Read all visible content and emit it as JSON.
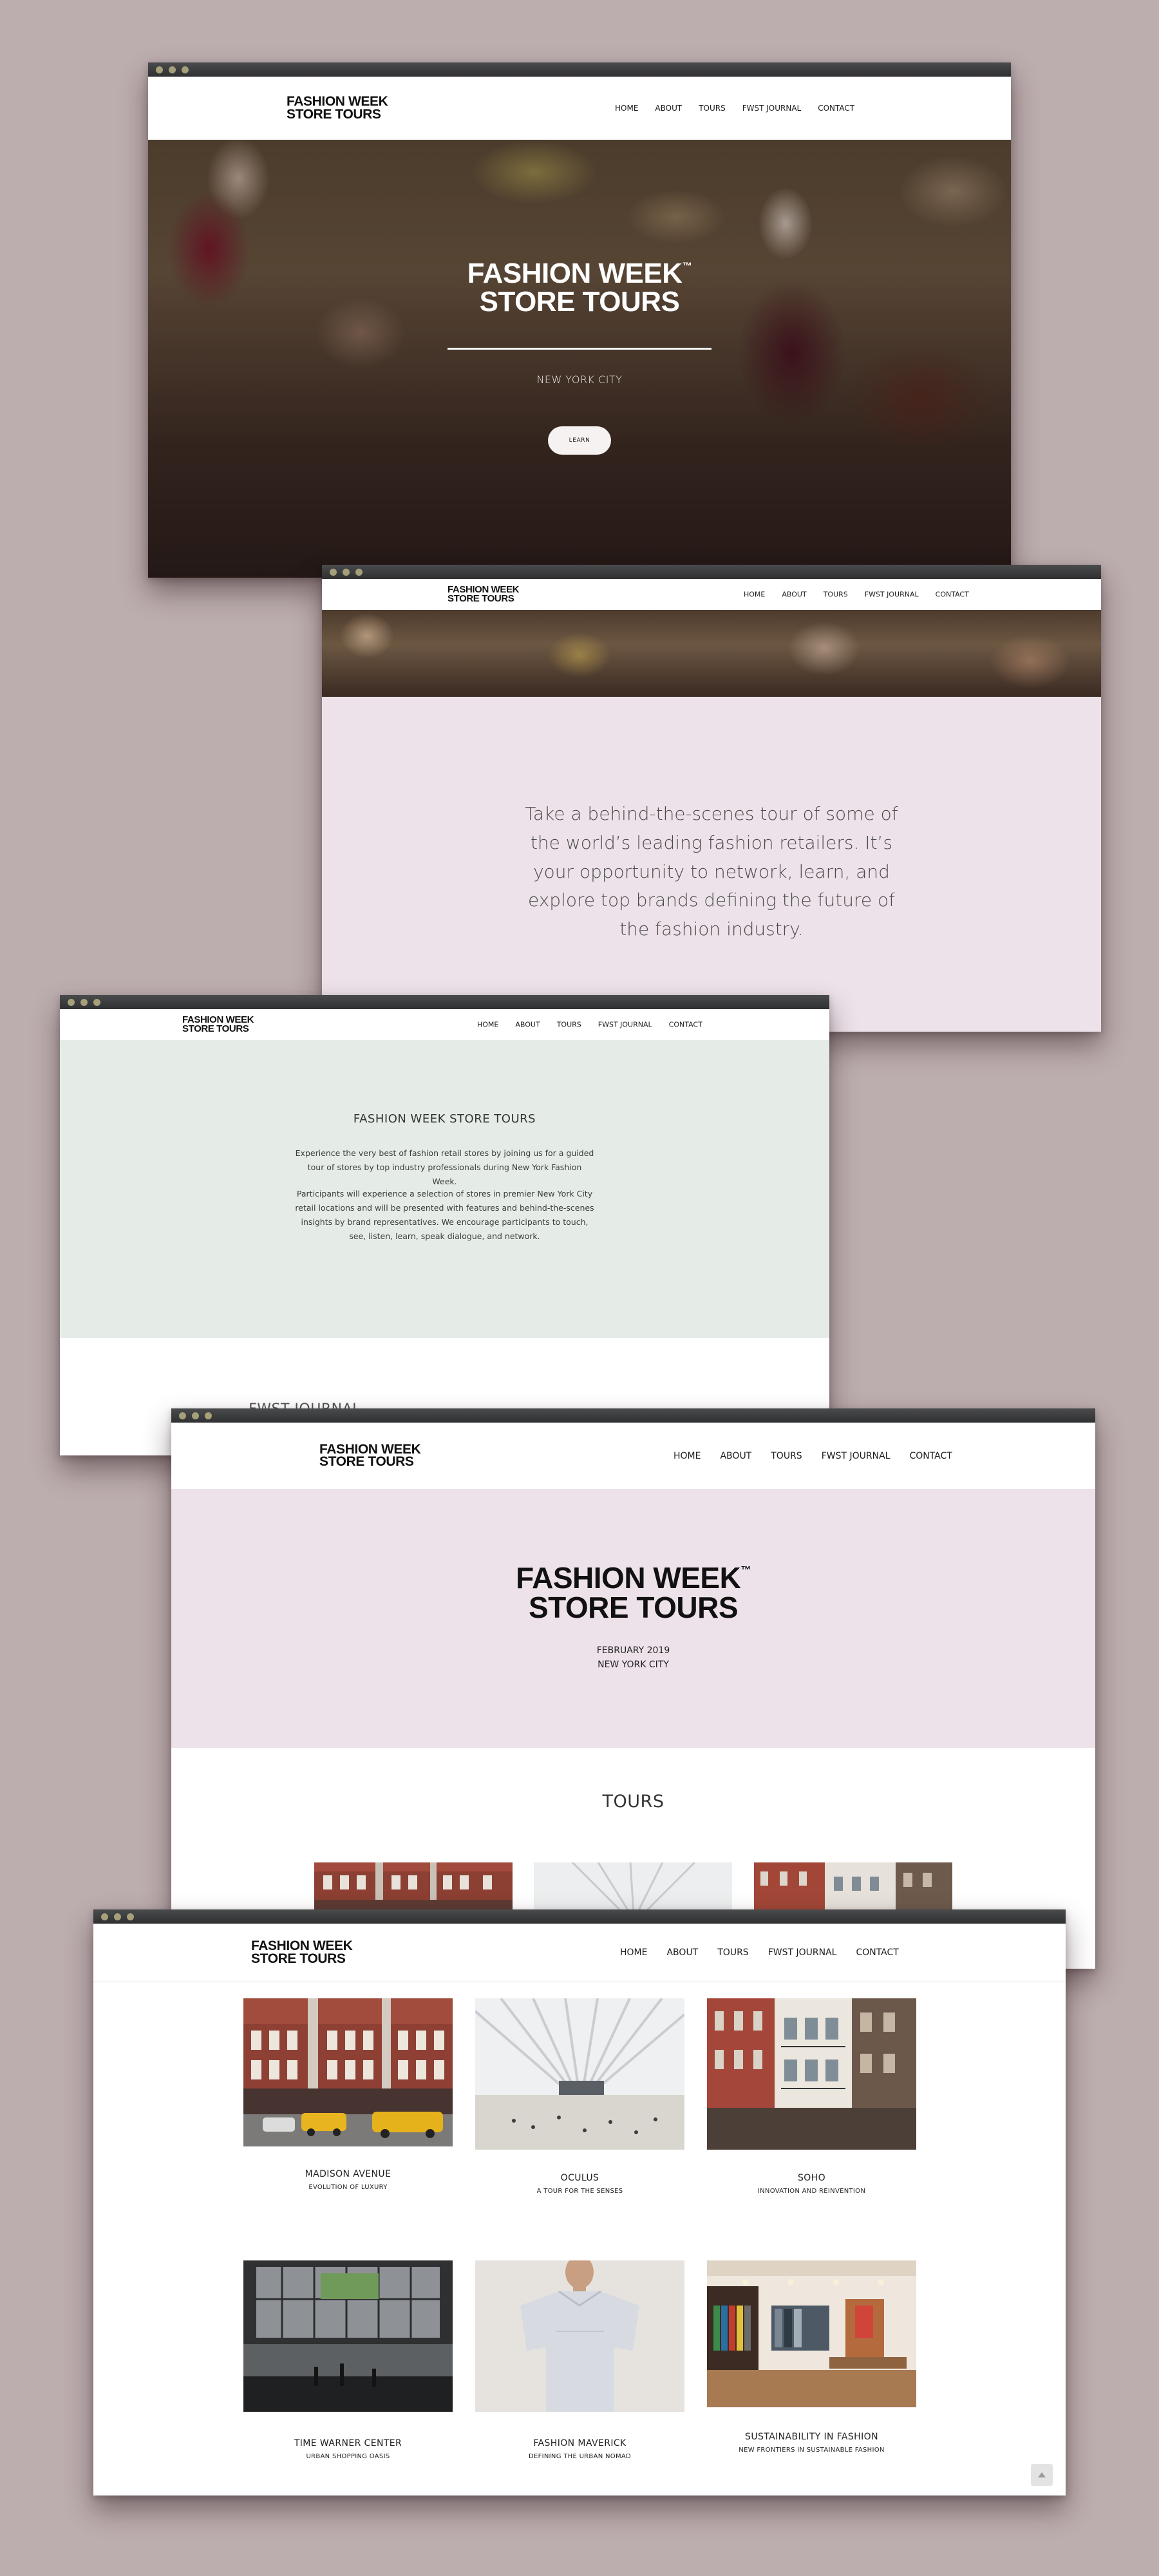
{
  "brand": {
    "logo_line1": "FASHION WEEK",
    "logo_line2": "STORE TOURS",
    "tm": "™"
  },
  "nav": {
    "home": "HOME",
    "about": "ABOUT",
    "tours": "TOURS",
    "journal": "FWST JOURNAL",
    "contact": "CONTACT"
  },
  "hero": {
    "title_line1": "FASHION WEEK",
    "title_line2": "STORE TOURS",
    "location": "NEW YORK CITY",
    "button_label": "LEARN"
  },
  "intro": {
    "text": "Take a behind-the-scenes tour of some of the world’s leading fashion retailers. It’s your opportunity to network, learn, and explore top brands defining the future of the fashion industry."
  },
  "about": {
    "heading": "FASHION WEEK STORE TOURS",
    "paragraph1": "Experience the very best of fashion retail stores by joining us for a guided tour of stores by top industry professionals during New York Fashion Week.",
    "paragraph2": "Participants will experience a selection of stores in premier New York City retail locations and will be presented with features and behind-the-scenes insights by brand representatives. We encourage participants to touch, see, listen, learn, speak dialogue, and network.",
    "journal_heading": "FWST JOURNAL"
  },
  "tours_page": {
    "date": "FEBRUARY 2019",
    "city": "NEW YORK CITY",
    "heading": "TOURS"
  },
  "tours": [
    {
      "name": "MADISON AVENUE",
      "subtitle": "EVOLUTION OF LUXURY"
    },
    {
      "name": "OCULUS",
      "subtitle": "A TOUR FOR THE SENSES"
    },
    {
      "name": "SOHO",
      "subtitle": "INNOVATION AND REINVENTION"
    },
    {
      "name": "TIME WARNER CENTER",
      "subtitle": "URBAN SHOPPING OASIS"
    },
    {
      "name": "FASHION MAVERICK",
      "subtitle": "DEFINING THE URBAN NOMAD"
    },
    {
      "name": "SUSTAINABILITY IN FASHION",
      "subtitle": "NEW FRONTIERS IN SUSTAINABLE FASHION"
    }
  ],
  "colors": {
    "background": "#bcadae",
    "pink_band": "#ede2ea",
    "mint_band": "#e5ece8",
    "window_chrome": "#3a3b3d",
    "traffic_light": "#a6a07a"
  }
}
